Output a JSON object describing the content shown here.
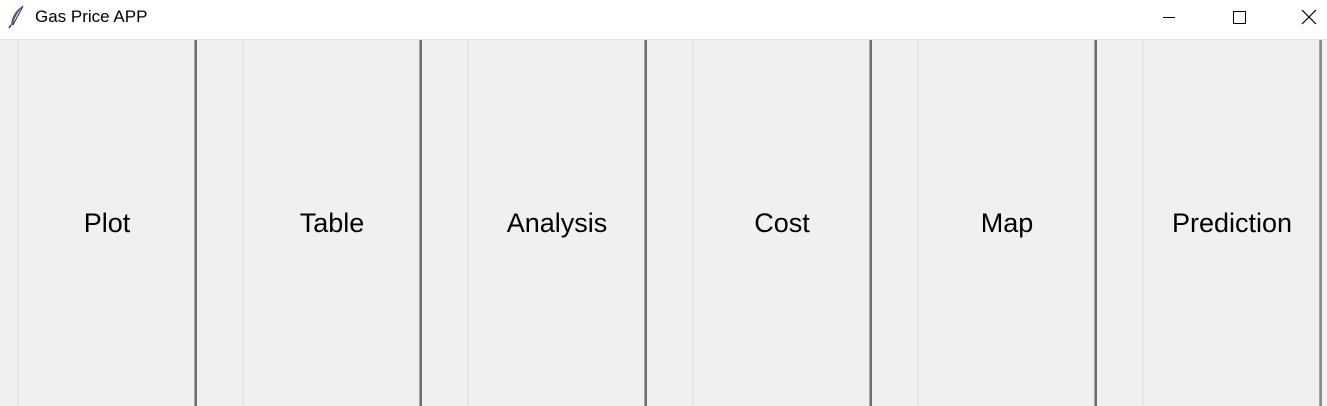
{
  "window": {
    "title": "Gas Price APP",
    "app_icon": "feather-icon",
    "controls": [
      "minimize-icon",
      "maximize-icon",
      "close-icon"
    ]
  },
  "buttons": [
    {
      "label": "Plot"
    },
    {
      "label": "Table"
    },
    {
      "label": "Analysis"
    },
    {
      "label": "Cost"
    },
    {
      "label": "Map"
    },
    {
      "label": "Prediction"
    }
  ]
}
